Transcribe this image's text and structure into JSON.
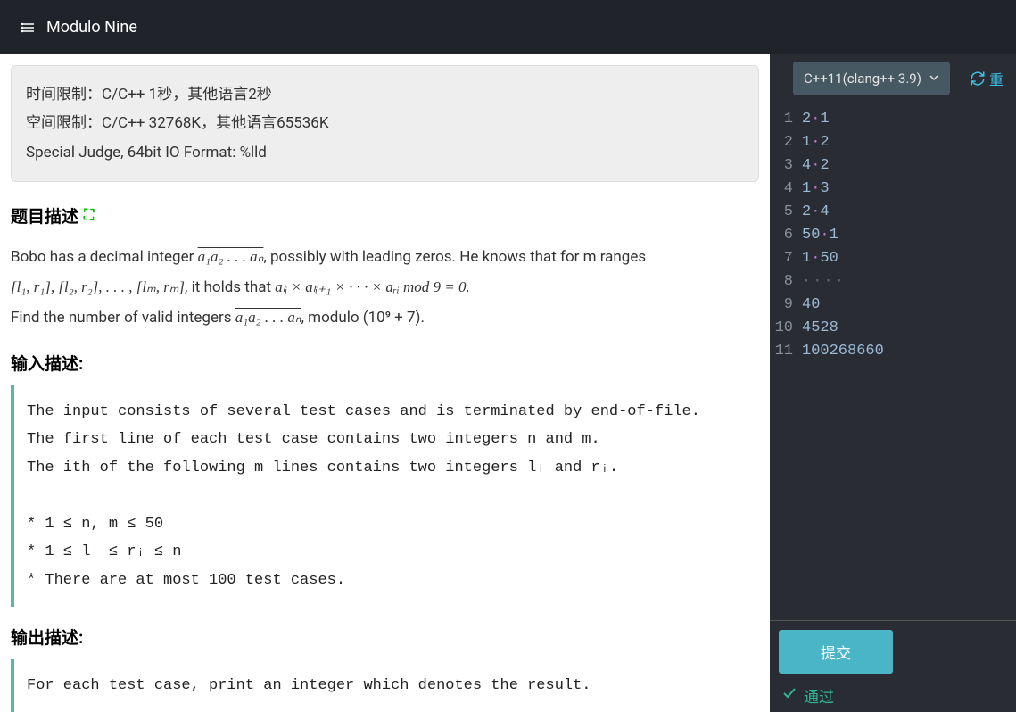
{
  "header": {
    "title": "Modulo Nine"
  },
  "limits": {
    "time": "时间限制：C/C++ 1秒，其他语言2秒",
    "memory": "空间限制：C/C++ 32768K，其他语言65536K",
    "special": "Special Judge, 64bit IO Format: %lld"
  },
  "sections": {
    "description_title": "题目描述",
    "input_title": "输入描述:",
    "output_title": "输出描述:"
  },
  "description": {
    "intro": "Bobo has a decimal integer ",
    "seq_over": "a₁a₂ . . . aₙ",
    "intro_tail": ", possibly with leading zeros. He knows that for m ranges ",
    "ranges": "[l₁, r₁], [l₂, r₂], . . . , [lₘ, rₘ]",
    "cond_pre": ", it holds that ",
    "product": "aₗᵢ × aₗᵢ₊₁ × · · · × aᵣᵢ  mod 9 = 0.",
    "find": "Find the number of valid integers ",
    "seq_over2": "a₁a₂ . . . aₙ",
    "find_tail": ", modulo (10⁹ + 7)."
  },
  "input_text": "The input consists of several test cases and is terminated by end-of-file.\nThe first line of each test case contains two integers n and m.\nThe ith of the following m lines contains two integers lᵢ and rᵢ.\n\n* 1 ≤ n, m ≤ 50\n* 1 ≤ lᵢ ≤ rᵢ ≤ n\n* There are at most 100 test cases.",
  "output_text": "For each test case, print an integer which denotes the result.",
  "editor": {
    "language": "C++11(clang++ 3.9)",
    "reload_label": "重",
    "lines": [
      {
        "num": "1",
        "a": "2",
        "op": "·",
        "b": "1"
      },
      {
        "num": "2",
        "a": "1",
        "op": "·",
        "b": "2"
      },
      {
        "num": "3",
        "a": "4",
        "op": "·",
        "b": "2"
      },
      {
        "num": "4",
        "a": "1",
        "op": "·",
        "b": "3"
      },
      {
        "num": "5",
        "a": "2",
        "op": "·",
        "b": "4"
      },
      {
        "num": "6",
        "a": "50",
        "op": "·",
        "b": "1"
      },
      {
        "num": "7",
        "a": "1",
        "op": "·",
        "b": "50"
      },
      {
        "num": "8",
        "a": "",
        "op": "····",
        "b": ""
      },
      {
        "num": "9",
        "a": "40",
        "op": "",
        "b": ""
      },
      {
        "num": "10",
        "a": "4528",
        "op": "",
        "b": ""
      },
      {
        "num": "11",
        "a": "100268660",
        "op": "",
        "b": ""
      }
    ]
  },
  "actions": {
    "submit": "提交",
    "status": "通过"
  }
}
